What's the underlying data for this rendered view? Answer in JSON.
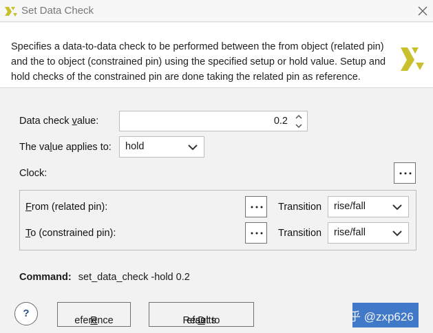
{
  "window": {
    "title": "Set Data Check"
  },
  "description": "Specifies a data-to-data check to be performed between the from object (related pin) and the to object (constrained pin) using the specified setup or hold value. Setup and hold checks of the constrained pin are done taking the related pin as reference.",
  "form": {
    "data_check_label_pre": "Data check ",
    "data_check_label_u": "v",
    "data_check_label_post": "alue:",
    "data_check_value": "0.2",
    "applies_label_pre": "The va",
    "applies_label_u": "l",
    "applies_label_post": "ue applies to:",
    "applies_value": "hold",
    "clock_label": "Clock:"
  },
  "pins": {
    "from_label_u": "F",
    "from_label_rest": "rom (related pin):",
    "to_label_u": "T",
    "to_label_rest": "o (constrained pin):",
    "transition_label": "Transition",
    "from_transition": "rise/fall",
    "to_transition": "rise/fall"
  },
  "command": {
    "label": "Command:",
    "text": "set_data_check -hold 0.2"
  },
  "buttons": {
    "help": "?",
    "reference_u": "R",
    "reference_rest": "eference",
    "reset_pre": "Reset to ",
    "reset_u": "D",
    "reset_post": "efaults"
  },
  "watermark": "知乎 @zxp626",
  "colors": {
    "brand_gold": "#c8c02c",
    "ok_button": "#3f79c8"
  }
}
